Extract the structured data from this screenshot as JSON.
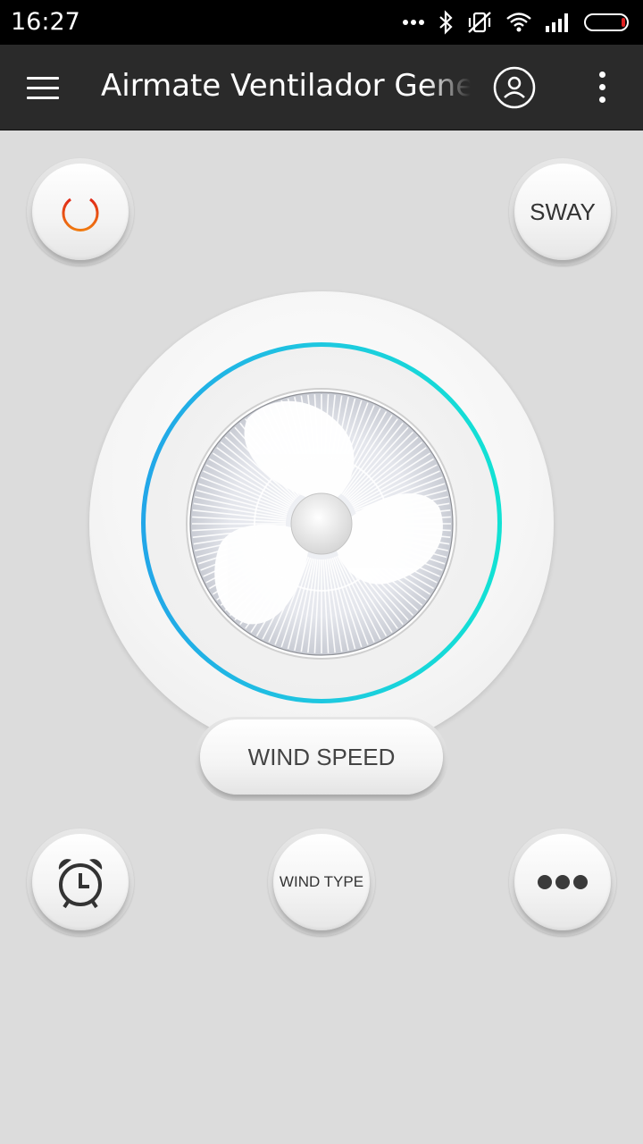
{
  "status_bar": {
    "time": "16:27",
    "icons": [
      "more-dots-icon",
      "bluetooth-icon",
      "vibrate-off-icon",
      "wifi-icon",
      "signal-icon",
      "battery-icon"
    ]
  },
  "app_bar": {
    "title": "Airmate Ventilador General",
    "menu_icon": "hamburger-menu-icon",
    "account_icon": "account-icon",
    "overflow_icon": "overflow-menu-icon"
  },
  "controls": {
    "power_icon": "power-icon",
    "sway_label": "SWAY",
    "wind_speed_label": "WIND SPEED",
    "timer_icon": "alarm-clock-icon",
    "wind_type_label": "WIND TYPE",
    "more_icon": "more-icon"
  },
  "colors": {
    "power_accent": "#e8420f",
    "ring_start": "#22a6e8",
    "ring_end": "#12e2d4",
    "app_bar": "#2a2a2a",
    "background": "#dcdcdc"
  }
}
